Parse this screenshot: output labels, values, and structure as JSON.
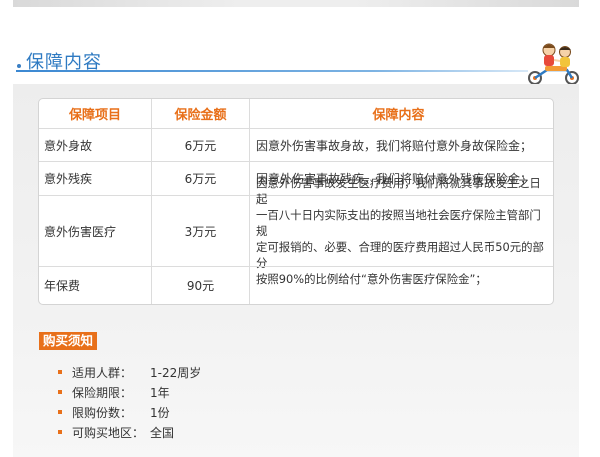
{
  "section": {
    "title": "保障内容"
  },
  "table": {
    "headers": [
      "保障项目",
      "保险金额",
      "保障内容"
    ],
    "rows": [
      {
        "item": "意外身故",
        "amount": "6万元",
        "desc": "因意外伤害事故身故，我们将赔付意外身故保险金；"
      },
      {
        "item": "意外残疾",
        "amount": "6万元",
        "desc": "因意外伤害事故残疾，我们将赔付意外残疾保险金；"
      },
      {
        "item": "意外伤害医疗",
        "amount": "3万元",
        "desc_lines": [
          "因意外伤害事故发生医疗费用，我们将就其事故发生之日起",
          "一百八十日内实际支出的按照当地社会医疗保险主管部门规",
          "定可报销的、必要、合理的医疗费用超过人民币50元的部分",
          "按照90%的比例给付“意外伤害医疗保险金”；"
        ]
      },
      {
        "item": "年保费",
        "amount": "90元",
        "desc": ""
      }
    ]
  },
  "notice": {
    "title": "购买须知",
    "items": [
      {
        "label": "适用人群：",
        "value": "1-22周岁"
      },
      {
        "label": "保险期限：",
        "value": "1年"
      },
      {
        "label": "限购份数：",
        "value": "1份"
      },
      {
        "label": "可购买地区：",
        "value": "全国"
      }
    ]
  },
  "colors": {
    "accent_orange": "#e8701a",
    "title_blue": "#2e7ac2"
  },
  "icons": {
    "header_illustration": "kids-on-tricycle-icon"
  }
}
